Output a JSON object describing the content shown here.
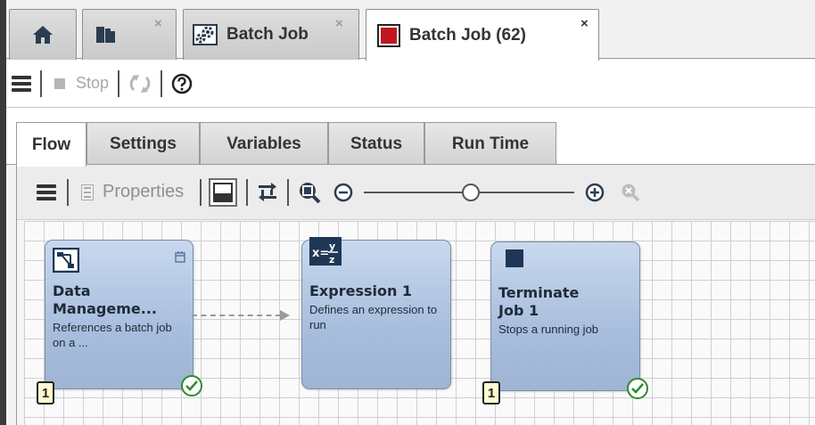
{
  "doc_tabs": [
    {
      "icon": "home-icon"
    },
    {
      "icon": "folders-icon",
      "close": "×"
    },
    {
      "icon": "gears-icon",
      "label": "Batch Job",
      "close": "×"
    },
    {
      "icon": "stop-square-icon",
      "label": "Batch Job (62)",
      "close": "×",
      "active": true
    }
  ],
  "toolbar": {
    "stop_label": "Stop"
  },
  "view_tabs": [
    {
      "label": "Flow",
      "active": true
    },
    {
      "label": "Settings"
    },
    {
      "label": "Variables"
    },
    {
      "label": "Status"
    },
    {
      "label": "Run Time"
    }
  ],
  "flow_toolbar": {
    "properties_label": "Properties",
    "zoom_level": 0.51
  },
  "nodes": [
    {
      "title": "Data Manageme...",
      "description": "References a batch job on a ...",
      "badge": "1",
      "status": "completed"
    },
    {
      "title": "Expression 1",
      "description": "Defines an expression to run"
    },
    {
      "title": "Terminate Job 1",
      "description": "Stops a running job",
      "badge": "1",
      "status": "completed"
    }
  ],
  "colors": {
    "node_fill": "#a8bedd",
    "stop_red": "#c0171f",
    "check_green": "#2e8a2e",
    "badge_fill": "#fffbd0"
  }
}
